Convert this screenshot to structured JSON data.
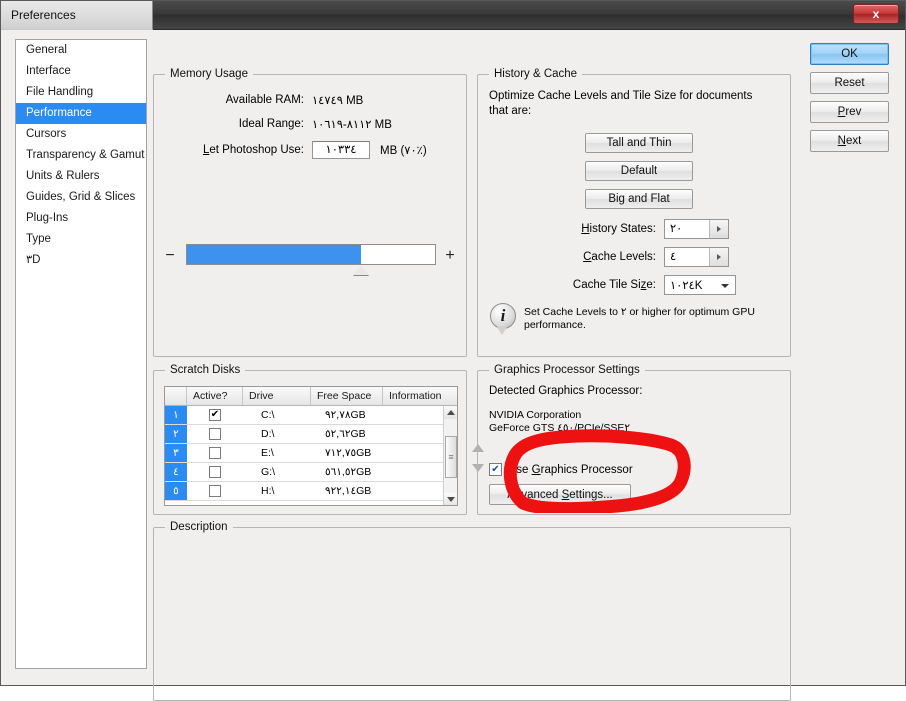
{
  "window": {
    "title": "Preferences",
    "close_label": "x"
  },
  "sidebar": {
    "items": [
      {
        "label": "General",
        "selected": false
      },
      {
        "label": "Interface",
        "selected": false
      },
      {
        "label": "File Handling",
        "selected": false
      },
      {
        "label": "Performance",
        "selected": true
      },
      {
        "label": "Cursors",
        "selected": false
      },
      {
        "label": "Transparency & Gamut",
        "selected": false
      },
      {
        "label": "Units & Rulers",
        "selected": false
      },
      {
        "label": "Guides, Grid & Slices",
        "selected": false
      },
      {
        "label": "Plug-Ins",
        "selected": false
      },
      {
        "label": "Type",
        "selected": false
      },
      {
        "label": "٣D",
        "selected": false
      }
    ]
  },
  "memory": {
    "group_title": "Memory Usage",
    "available_ram_label": "Available RAM:",
    "available_ram_value": "١٤٧٤٩ MB",
    "ideal_range_label": "Ideal Range:",
    "ideal_range_value": "٨١١٢-١٠٦١٩ MB",
    "let_photoshop_use_label": "Let Photoshop Use:",
    "let_photoshop_use_value": "١٠٣٣٤",
    "let_photoshop_use_suffix": "MB (٧٠٪)",
    "slider_minus": "−",
    "slider_plus": "+",
    "slider_percent": 70
  },
  "history_cache": {
    "group_title": "History & Cache",
    "optimize_text": "Optimize Cache Levels and Tile Size for documents that are:",
    "buttons": [
      {
        "label": "Tall and Thin"
      },
      {
        "label": "Default"
      },
      {
        "label": "Big and Flat"
      }
    ],
    "history_states_label": "History States:",
    "history_states_value": "٢٠",
    "cache_levels_label": "Cache Levels:",
    "cache_levels_value": "٤",
    "cache_tile_size_label": "Cache Tile Size:",
    "cache_tile_size_value": "١٠٢٤K",
    "info_icon": "i",
    "info_text": "Set Cache Levels to ٢ or higher for optimum GPU performance."
  },
  "scratch_disks": {
    "group_title": "Scratch Disks",
    "columns": [
      "",
      "Active?",
      "Drive",
      "Free Space",
      "Information"
    ],
    "rows": [
      {
        "num": "١",
        "active": true,
        "check": "✔",
        "drive": "C:\\",
        "free": "٩٢,٧٨GB",
        "info": ""
      },
      {
        "num": "٢",
        "active": false,
        "check": "",
        "drive": "D:\\",
        "free": "٥٢,٦٢GB",
        "info": ""
      },
      {
        "num": "٣",
        "active": false,
        "check": "",
        "drive": "E:\\",
        "free": "٧١٢,٧٥GB",
        "info": ""
      },
      {
        "num": "٤",
        "active": false,
        "check": "",
        "drive": "G:\\",
        "free": "٥٦١,٥٢GB",
        "info": ""
      },
      {
        "num": "٥",
        "active": false,
        "check": "",
        "drive": "H:\\",
        "free": "٩٢٢,١٤GB",
        "info": ""
      }
    ]
  },
  "gpu": {
    "group_title": "Graphics Processor Settings",
    "detected_label": "Detected Graphics Processor:",
    "vendor": "NVIDIA Corporation",
    "model": "GeForce GTS ٤٥٠/PCIe/SSE٢",
    "use_gpu_label": "Use Graphics Processor",
    "use_gpu_checked": true,
    "use_gpu_check": "✔",
    "advanced_settings_label": "Advanced Settings..."
  },
  "description": {
    "group_title": "Description",
    "text": ""
  },
  "actions": {
    "ok": "OK",
    "reset": "Reset",
    "prev": "Prev",
    "next": "Next"
  },
  "colors": {
    "accent": "#2a8bf2",
    "slider_fill": "#3c92ec",
    "annotation": "#ee1111",
    "dialog_bg": "#f0efee"
  }
}
